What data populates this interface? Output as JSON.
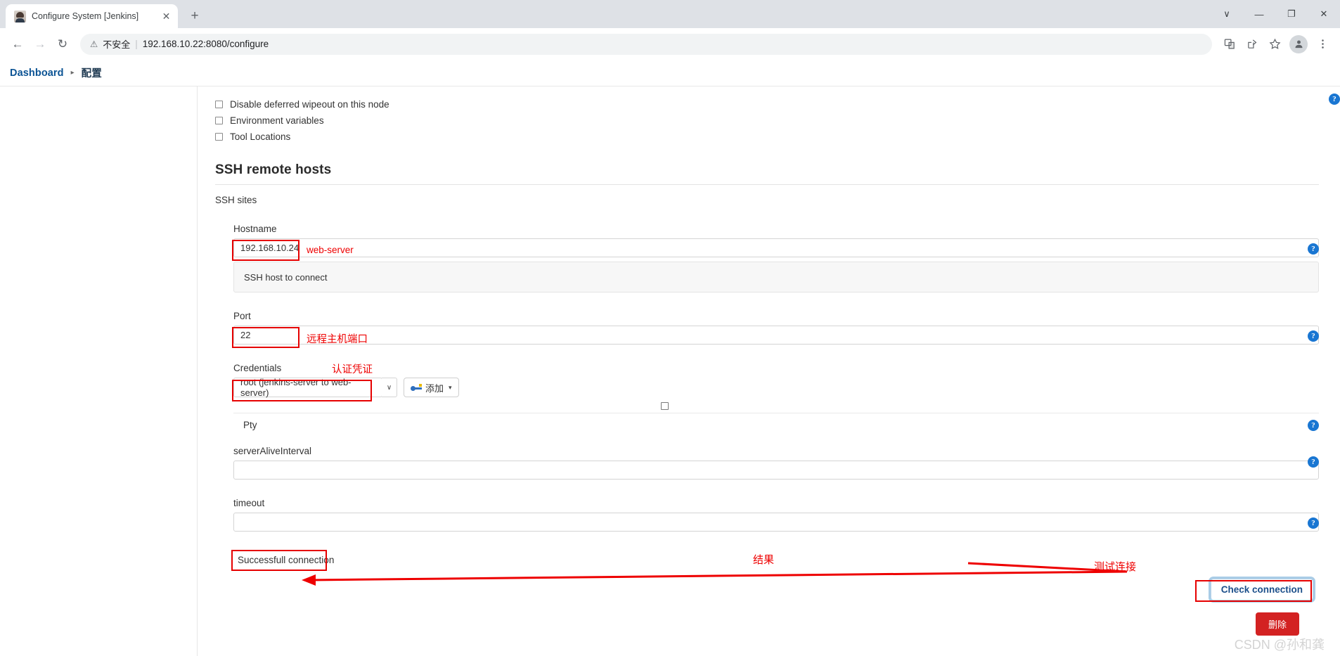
{
  "browser": {
    "tab_title": "Configure System [Jenkins]",
    "close_tab_glyph": "✕",
    "new_tab_glyph": "+",
    "back_glyph": "←",
    "forward_glyph": "→",
    "reload_glyph": "↻",
    "warning_glyph": "⚠",
    "insecure_label": "不安全",
    "separator": "|",
    "url": "192.168.10.22:8080/configure",
    "window_minimize": "—",
    "window_maximize": "❐",
    "window_close": "✕",
    "window_chevron": "∨"
  },
  "breadcrumb": {
    "items": [
      "Dashboard",
      "配置"
    ],
    "separator": "▸"
  },
  "node_options": {
    "checkboxes": [
      {
        "label": "Disable deferred wipeout on this node",
        "checked": false
      },
      {
        "label": "Environment variables",
        "checked": false
      },
      {
        "label": "Tool Locations",
        "checked": false
      }
    ]
  },
  "ssh_section": {
    "title": "SSH remote hosts",
    "sites_label": "SSH sites",
    "hostname": {
      "label": "Hostname",
      "value": "192.168.10.24",
      "help_text": "SSH host to connect",
      "help_icon": "?"
    },
    "port": {
      "label": "Port",
      "value": "22",
      "help_icon": "?"
    },
    "credentials": {
      "label": "Credentials",
      "selected": "root (jenkins-server to web-server)",
      "caret": "∨",
      "add_button": "添加",
      "add_caret": "▾"
    },
    "pty": {
      "label": "Pty",
      "checked": false,
      "help_icon": "?"
    },
    "server_alive_interval": {
      "label": "serverAliveInterval",
      "value": "",
      "help_icon": "?"
    },
    "timeout": {
      "label": "timeout",
      "value": "",
      "help_icon": "?"
    },
    "result_text": "Successfull connection",
    "check_connection_button": "Check connection",
    "delete_button": "删除"
  },
  "annotations": {
    "hostname_note": "web-server",
    "port_note": "远程主机端口",
    "credentials_note": "认证凭证",
    "result_note": "结果",
    "check_note": "测试连接"
  },
  "watermark": "CSDN @孙和龚",
  "colors": {
    "annotation_red": "#ee0000",
    "jenkins_link": "#0b5394",
    "help_blue": "#1976d2",
    "delete_red": "#d32222"
  }
}
